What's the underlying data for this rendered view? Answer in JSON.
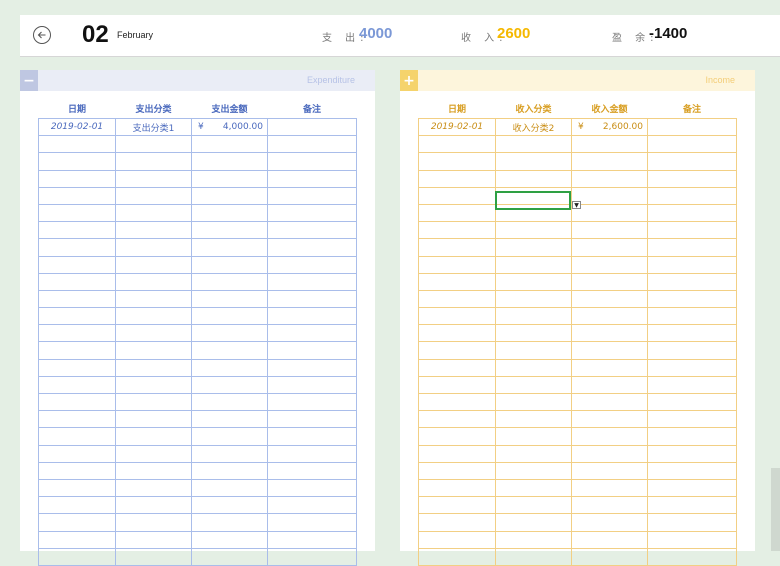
{
  "header": {
    "day": "02",
    "month": "February",
    "expense_label": "支 出:",
    "expense_value": "4000",
    "income_label": "收 入:",
    "income_value": "2600",
    "balance_label": "盈 余:",
    "balance_value": "-1400"
  },
  "colors": {
    "expense_accent": "#7b98d6",
    "income_accent": "#f5b800",
    "balance": "#111111"
  },
  "expenditure": {
    "toggle_symbol": "−",
    "title": "Expenditure",
    "columns": [
      "日期",
      "支出分类",
      "支出金额",
      "备注"
    ],
    "rows": [
      {
        "date": "2019-02-01",
        "category": "支出分类1",
        "currency": "¥",
        "amount": "4,000.00",
        "note": ""
      }
    ]
  },
  "income": {
    "toggle_symbol": "+",
    "title": "Income",
    "columns": [
      "日期",
      "收入分类",
      "收入金额",
      "备注"
    ],
    "rows": [
      {
        "date": "2019-02-01",
        "category": "收入分类2",
        "currency": "¥",
        "amount": "2,600.00",
        "note": ""
      }
    ]
  },
  "icons": [
    "back-arrow-icon",
    "dropdown-arrow-icon"
  ]
}
